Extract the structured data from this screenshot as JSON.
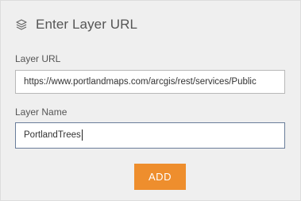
{
  "header": {
    "icon": "layers-icon",
    "title": "Enter Layer URL"
  },
  "form": {
    "layer_url_label": "Layer URL",
    "layer_url_value": "https://www.portlandmaps.com/arcgis/rest/services/Public",
    "layer_name_label": "Layer Name",
    "layer_name_value": "PortlandTrees"
  },
  "actions": {
    "add_label": "ADD"
  },
  "colors": {
    "panel_bg": "#efefef",
    "accent": "#ee8e2d",
    "focus_border": "#6a7d9a"
  }
}
